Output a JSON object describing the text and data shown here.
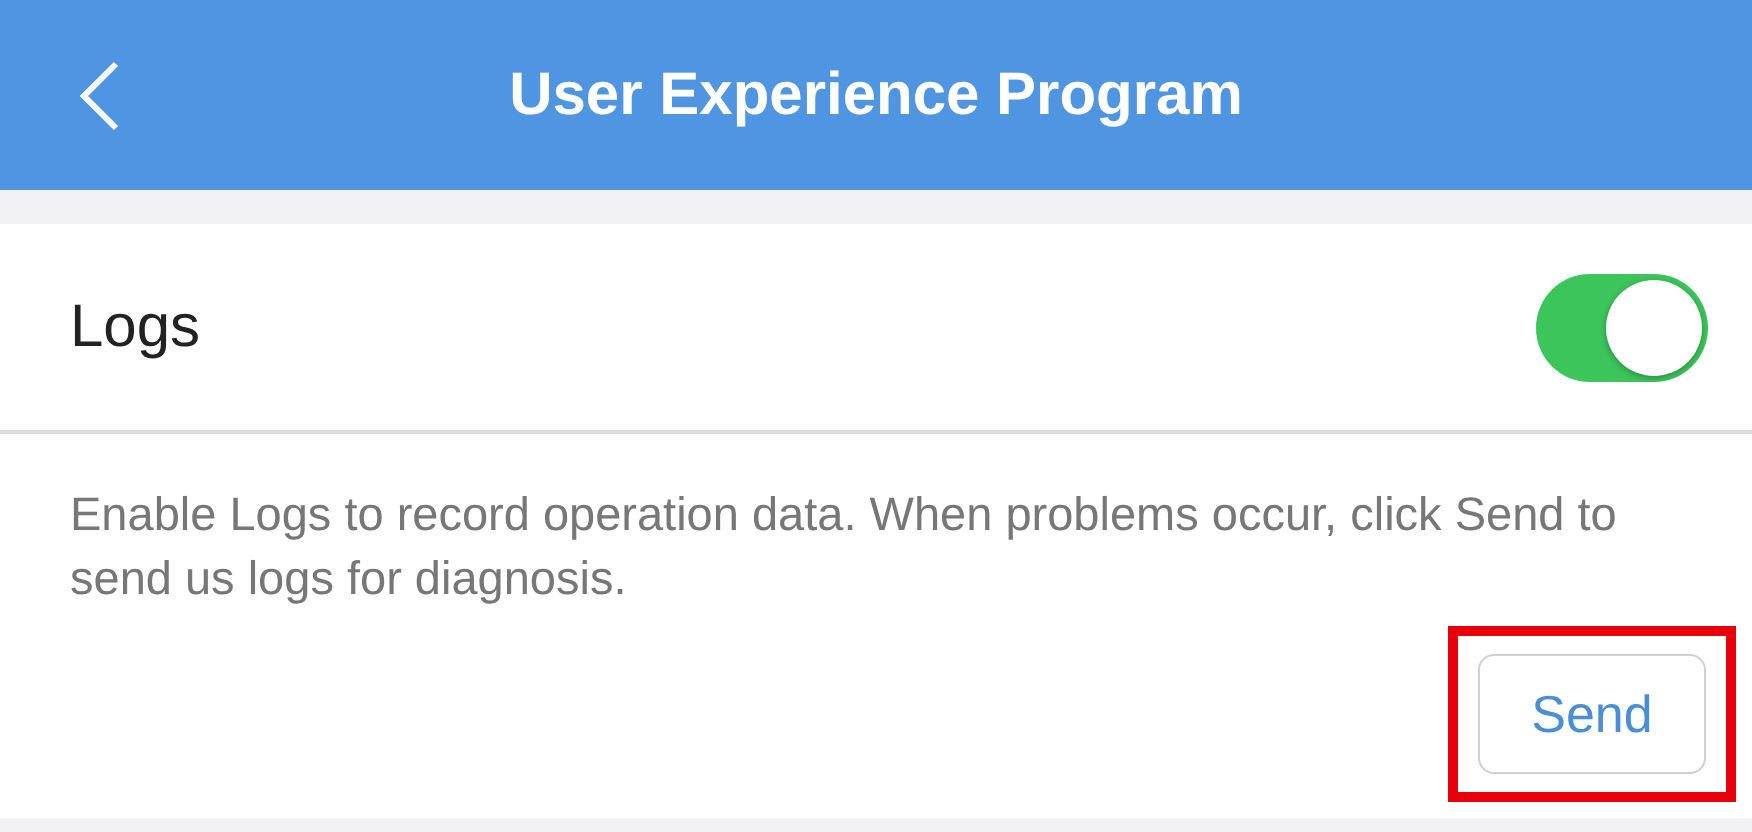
{
  "header": {
    "title": "User Experience Program"
  },
  "logs": {
    "label": "Logs",
    "on": true
  },
  "description": "Enable Logs to record operation data. When problems occur, click Send to send us logs for diagnosis.",
  "send_button": {
    "label": "Send",
    "highlighted": true
  }
}
